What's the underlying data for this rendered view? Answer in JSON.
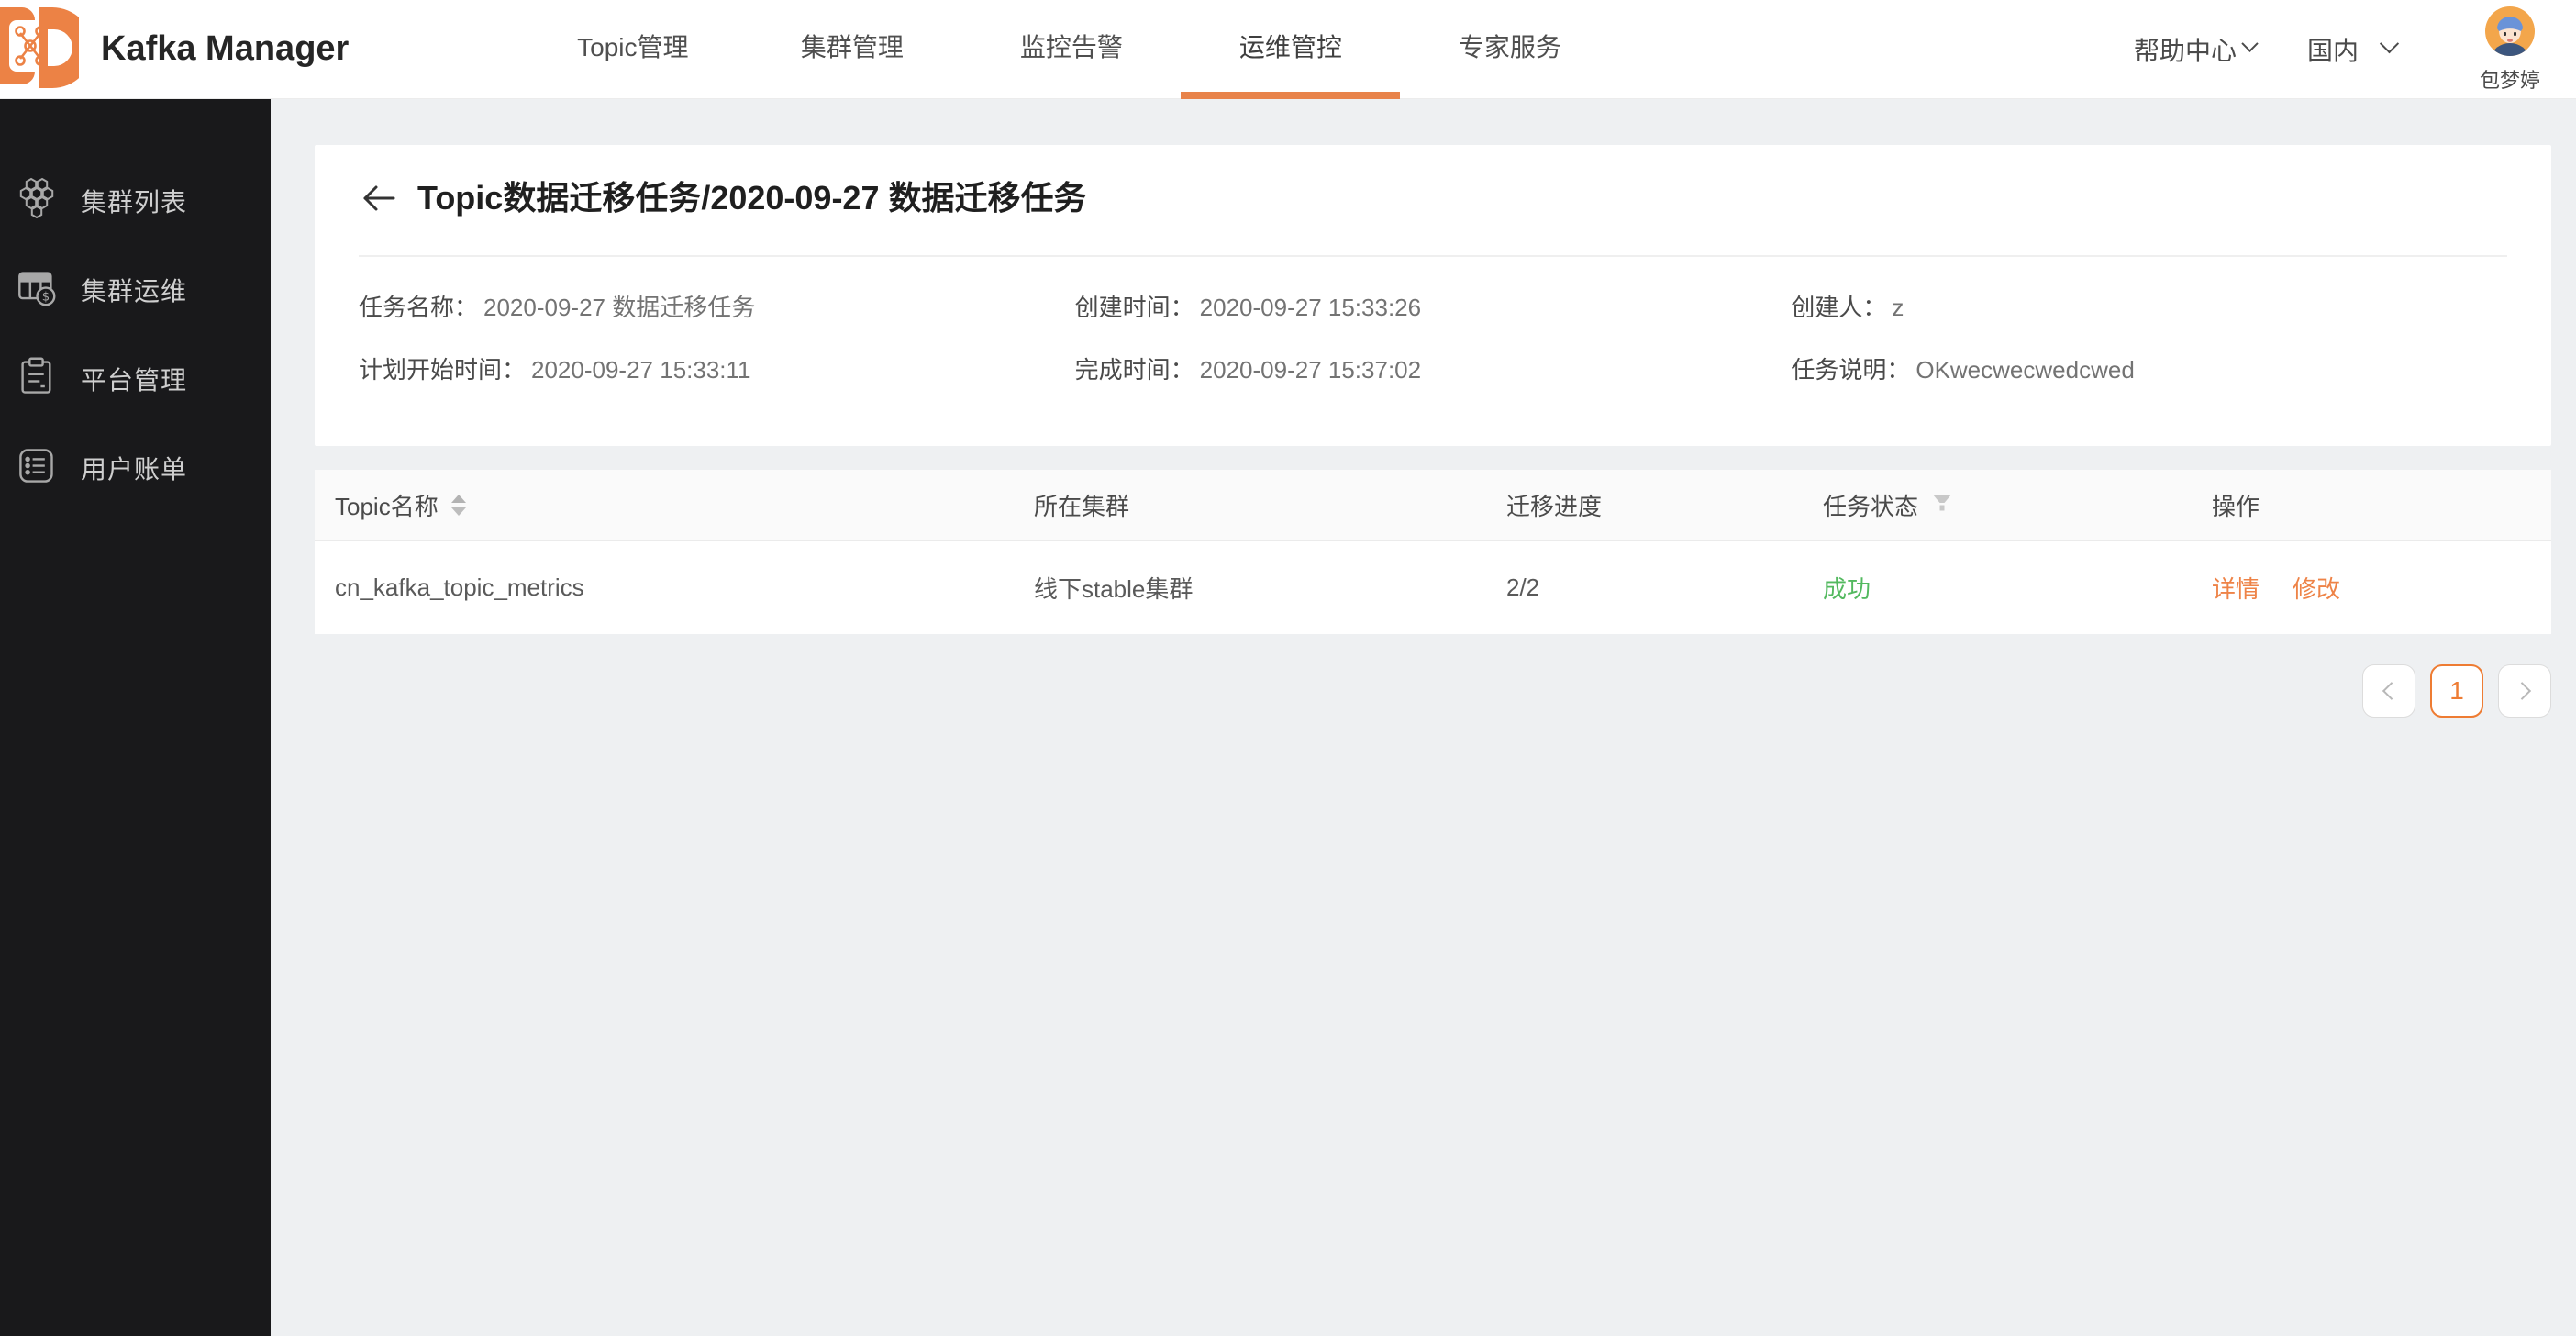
{
  "header": {
    "app_title": "Kafka Manager",
    "nav": [
      {
        "label": "Topic管理",
        "active": false
      },
      {
        "label": "集群管理",
        "active": false
      },
      {
        "label": "监控告警",
        "active": false
      },
      {
        "label": "运维管控",
        "active": true
      },
      {
        "label": "专家服务",
        "active": false
      }
    ],
    "help_center": "帮助中心",
    "region": "国内",
    "username": "包梦婷"
  },
  "sidebar": {
    "items": [
      {
        "label": "集群列表",
        "icon": "honeycomb-cluster-icon"
      },
      {
        "label": "集群运维",
        "icon": "table-finance-icon"
      },
      {
        "label": "平台管理",
        "icon": "clipboard-icon"
      },
      {
        "label": "用户账单",
        "icon": "bill-list-icon"
      }
    ]
  },
  "page": {
    "title": "Topic数据迁移任务/2020-09-27 数据迁移任务",
    "info_fields": [
      {
        "label": "任务名称：",
        "value": "2020-09-27 数据迁移任务"
      },
      {
        "label": "创建时间：",
        "value": "2020-09-27 15:33:26"
      },
      {
        "label": "创建人：",
        "value": "z"
      },
      {
        "label": "计划开始时间：",
        "value": "2020-09-27 15:33:11"
      },
      {
        "label": "完成时间：",
        "value": "2020-09-27 15:37:02"
      },
      {
        "label": "任务说明：",
        "value": "OKwecwecwedcwed"
      }
    ]
  },
  "table": {
    "columns": [
      {
        "label": "Topic名称",
        "sortable": true
      },
      {
        "label": "所在集群"
      },
      {
        "label": "迁移进度"
      },
      {
        "label": "任务状态",
        "filterable": true
      },
      {
        "label": "操作"
      }
    ],
    "rows": [
      {
        "topic": "cn_kafka_topic_metrics",
        "cluster": "线下stable集群",
        "progress": "2/2",
        "status": "成功",
        "action_detail": "详情",
        "action_edit": "修改"
      }
    ]
  },
  "pagination": {
    "current_page": "1"
  },
  "colors": {
    "accent_orange": "#ee7c33",
    "link_orange": "#ee8347",
    "success_green": "#53b95f",
    "sidebar_bg": "#19191b",
    "page_bg": "#eef0f2"
  },
  "icons": {
    "kafka_logo_icon": "orange-D-molecule",
    "back_icon": "←",
    "chevron_down_icon": "∨",
    "sort_icon": "▲▼",
    "filter_icon": "funnel",
    "prev_page_icon": "‹",
    "next_page_icon": "›"
  }
}
